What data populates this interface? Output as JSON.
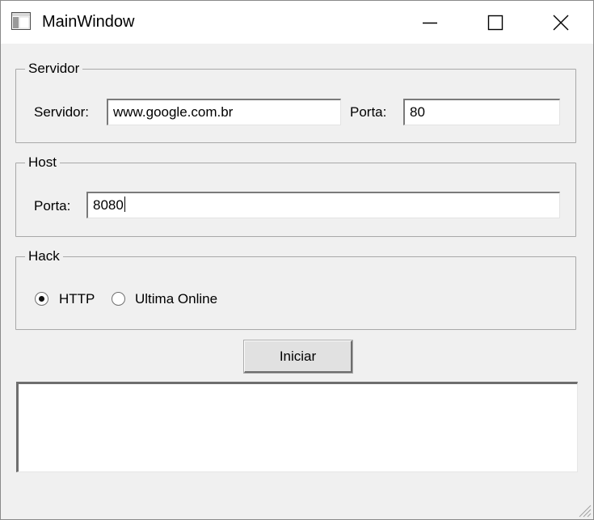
{
  "window": {
    "title": "MainWindow",
    "icons": {
      "app": "app-window-icon",
      "minimize": "minimize-icon",
      "maximize": "maximize-icon",
      "close": "close-icon"
    }
  },
  "servidor_group": {
    "title": "Servidor",
    "server_label": "Servidor:",
    "server_value": "www.google.com.br",
    "port_label": "Porta:",
    "port_value": "80"
  },
  "host_group": {
    "title": "Host",
    "port_label": "Porta:",
    "port_value": "8080"
  },
  "hack_group": {
    "title": "Hack",
    "options": [
      {
        "label": "HTTP",
        "selected": true
      },
      {
        "label": "Ultima Online",
        "selected": false
      }
    ]
  },
  "actions": {
    "start_label": "Iniciar"
  },
  "output": {
    "text": ""
  }
}
